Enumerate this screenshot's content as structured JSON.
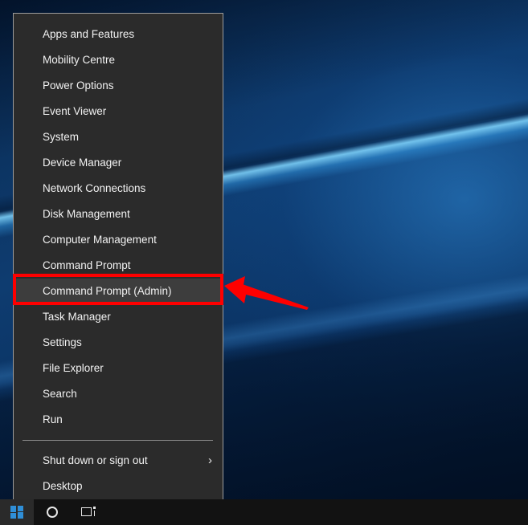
{
  "desktop": {
    "wallpaper_name": "windows-10-hero-wallpaper",
    "colors": {
      "wallpaper_base": "#0d3a6b",
      "wallpaper_highlight": "#82d7ff",
      "wallpaper_shadow": "#010e22"
    }
  },
  "winx_menu": {
    "name": "power-user-menu",
    "background_color": "#2b2b2b",
    "border_color": "#9c9c9c",
    "hover_color": "#3d3d3d",
    "text_color": "#f2f2f2",
    "items": [
      {
        "label": "Apps and Features",
        "hovered": false,
        "submenu": false
      },
      {
        "label": "Mobility Centre",
        "hovered": false,
        "submenu": false
      },
      {
        "label": "Power Options",
        "hovered": false,
        "submenu": false
      },
      {
        "label": "Event Viewer",
        "hovered": false,
        "submenu": false
      },
      {
        "label": "System",
        "hovered": false,
        "submenu": false
      },
      {
        "label": "Device Manager",
        "hovered": false,
        "submenu": false
      },
      {
        "label": "Network Connections",
        "hovered": false,
        "submenu": false
      },
      {
        "label": "Disk Management",
        "hovered": false,
        "submenu": false
      },
      {
        "label": "Computer Management",
        "hovered": false,
        "submenu": false
      },
      {
        "label": "Command Prompt",
        "hovered": false,
        "submenu": false
      },
      {
        "label": "Command Prompt (Admin)",
        "hovered": true,
        "submenu": false
      },
      {
        "label": "Task Manager",
        "hovered": false,
        "submenu": false
      },
      {
        "label": "Settings",
        "hovered": false,
        "submenu": false
      },
      {
        "label": "File Explorer",
        "hovered": false,
        "submenu": false
      },
      {
        "label": "Search",
        "hovered": false,
        "submenu": false
      },
      {
        "label": "Run",
        "hovered": false,
        "submenu": false
      }
    ],
    "separator_after_index": 15,
    "items_after_separator": [
      {
        "label": "Shut down or sign out",
        "hovered": false,
        "submenu": true,
        "submenu_glyph": "›"
      },
      {
        "label": "Desktop",
        "hovered": false,
        "submenu": false
      }
    ]
  },
  "annotations": {
    "highlight_rectangle": {
      "target_label": "Command Prompt (Admin)",
      "color": "#fe0000"
    },
    "arrow": {
      "direction": "left",
      "points_to": "Command Prompt (Admin)",
      "color": "#fe0000"
    }
  },
  "taskbar": {
    "background_color": "#121212",
    "buttons": [
      {
        "name": "start-button",
        "label": "Start",
        "icon": "windows-logo-icon",
        "active": true
      },
      {
        "name": "cortana-button",
        "label": "Cortana",
        "icon": "cortana-circle-icon",
        "active": false
      },
      {
        "name": "task-view-button",
        "label": "Task View",
        "icon": "task-view-icon",
        "active": false
      }
    ]
  }
}
